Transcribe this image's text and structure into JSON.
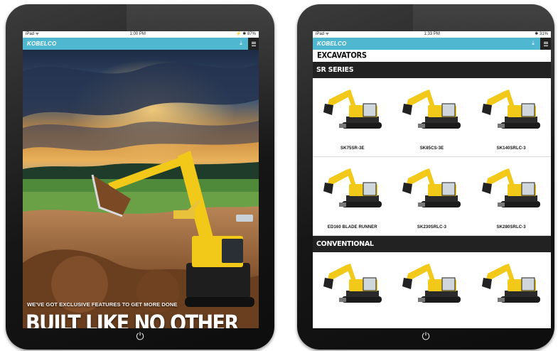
{
  "left_tablet": {
    "status": {
      "left": "iPad ᯤ",
      "time": "1:00 PM",
      "right": "⚡ ✱ 87%"
    },
    "brand": "KOBELCO",
    "tagline": "WE'VE GOT EXCLUSIVE FEATURES TO GET MORE DONE",
    "headline": "BUILT LIKE NO OTHER",
    "icons": {
      "download": "download-icon",
      "menu": "menu-icon",
      "home": "power-icon"
    }
  },
  "right_tablet": {
    "status": {
      "left": "iPad ᯤ",
      "time": "1:33 PM",
      "right": "✱ 31%"
    },
    "brand": "KOBELCO",
    "category": "EXCAVATORS",
    "sections": [
      {
        "title": "SR SERIES",
        "models": [
          "SK75SR-3E",
          "SK85CS-3E",
          "SK140SRLC-3",
          "ED160 BLADE RUNNER",
          "SK230SRLC-3",
          "SK280SRLC-3"
        ]
      },
      {
        "title": "CONVENTIONAL",
        "models": [
          "",
          "",
          ""
        ]
      }
    ],
    "colors": {
      "accent": "#4fb7cf",
      "machine": "#f2c919",
      "section_bar": "#222222"
    }
  }
}
